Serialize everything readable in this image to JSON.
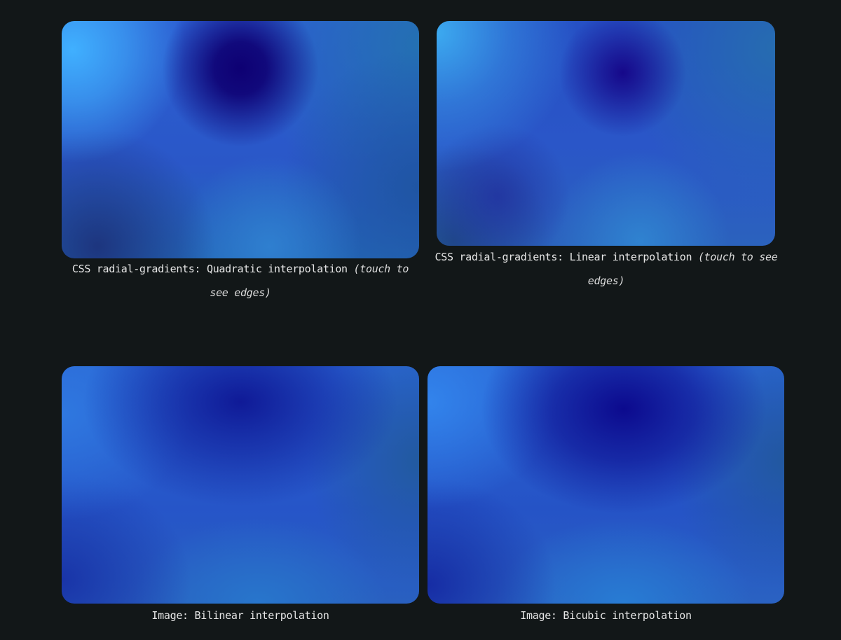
{
  "figures": [
    {
      "id": "quadratic",
      "caption_main": "CSS radial-gradients: Quadratic interpolation",
      "caption_note": "(touch to see edges)"
    },
    {
      "id": "linear",
      "caption_main": "CSS radial-gradients: Linear interpolation",
      "caption_note": "(touch to see edges)"
    },
    {
      "id": "bilinear",
      "caption_main": "Image: Bilinear interpolation"
    },
    {
      "id": "bicubic",
      "caption_main": "Image: Bicubic interpolation"
    }
  ],
  "colors": {
    "page_background": "#121718",
    "caption_text": "#e6e6e6",
    "deep_indigo": "#0e0073",
    "bright_sky": "#40b0ff",
    "mid_blue": "#2a56c8"
  }
}
